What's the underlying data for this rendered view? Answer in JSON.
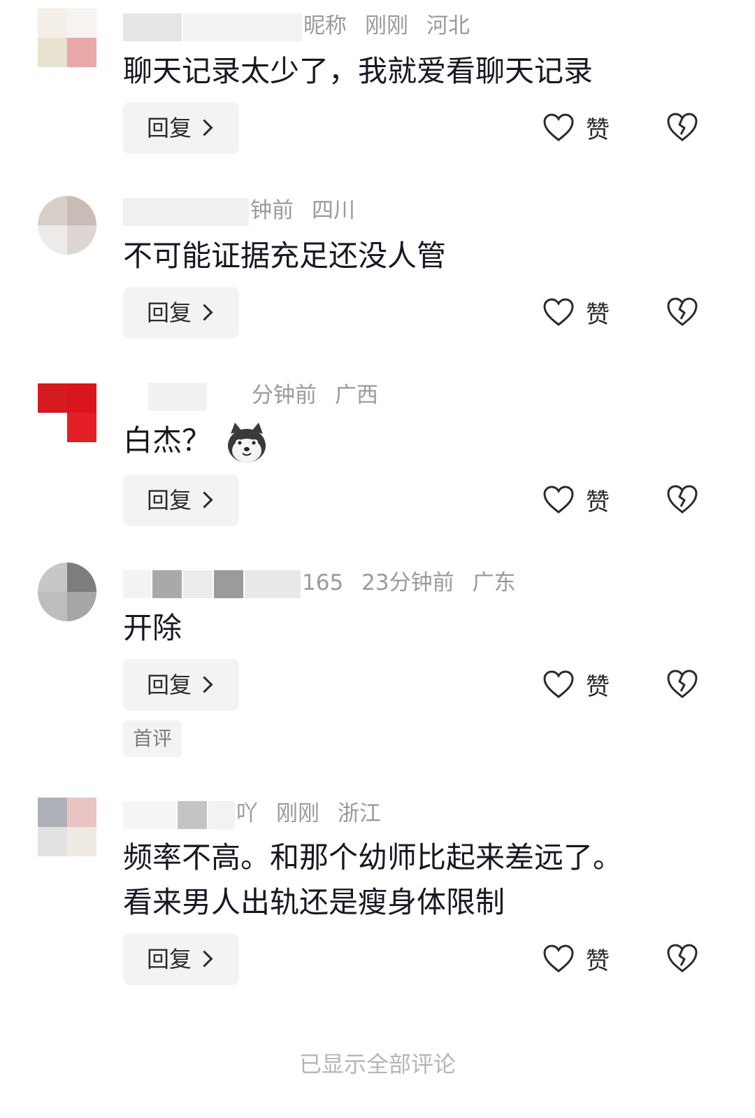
{
  "comments": [
    {
      "meta": {
        "user_tail": "昵称",
        "time": "刚刚",
        "location": "河北"
      },
      "text": [
        "聊天记录太少了，我就爱看聊天记录"
      ],
      "reply_label": "回复",
      "like_label": "赞"
    },
    {
      "meta": {
        "user_tail": "",
        "time": "钟前",
        "location": "四川"
      },
      "text": [
        "不可能证据充足还没人管"
      ],
      "reply_label": "回复",
      "like_label": "赞"
    },
    {
      "meta": {
        "user_tail": "",
        "time": "分钟前",
        "location": "广西"
      },
      "text": [
        "白杰？"
      ],
      "emoji": "husky-emoji",
      "reply_label": "回复",
      "like_label": "赞"
    },
    {
      "meta": {
        "user_tail": "165",
        "time": "23分钟前",
        "location": "广东"
      },
      "text": [
        "开除"
      ],
      "reply_label": "回复",
      "like_label": "赞",
      "tag": "首评"
    },
    {
      "meta": {
        "user_tail": "吖",
        "time": "刚刚",
        "location": "浙江"
      },
      "text": [
        "频率不高。和那个幼师比起来差远了。",
        "看来男人出轨还是瘦身体限制"
      ],
      "reply_label": "回复",
      "like_label": "赞"
    }
  ],
  "footer": "已显示全部评论",
  "icons": {
    "like": "heart-outline-icon",
    "dislike": "broken-heart-icon",
    "reply_arrow": "chevron-right-icon"
  },
  "colors": {
    "text": "#161823",
    "meta": "#9a9a9e",
    "button_bg": "#f3f3f4",
    "footer": "#b5b5b8"
  }
}
